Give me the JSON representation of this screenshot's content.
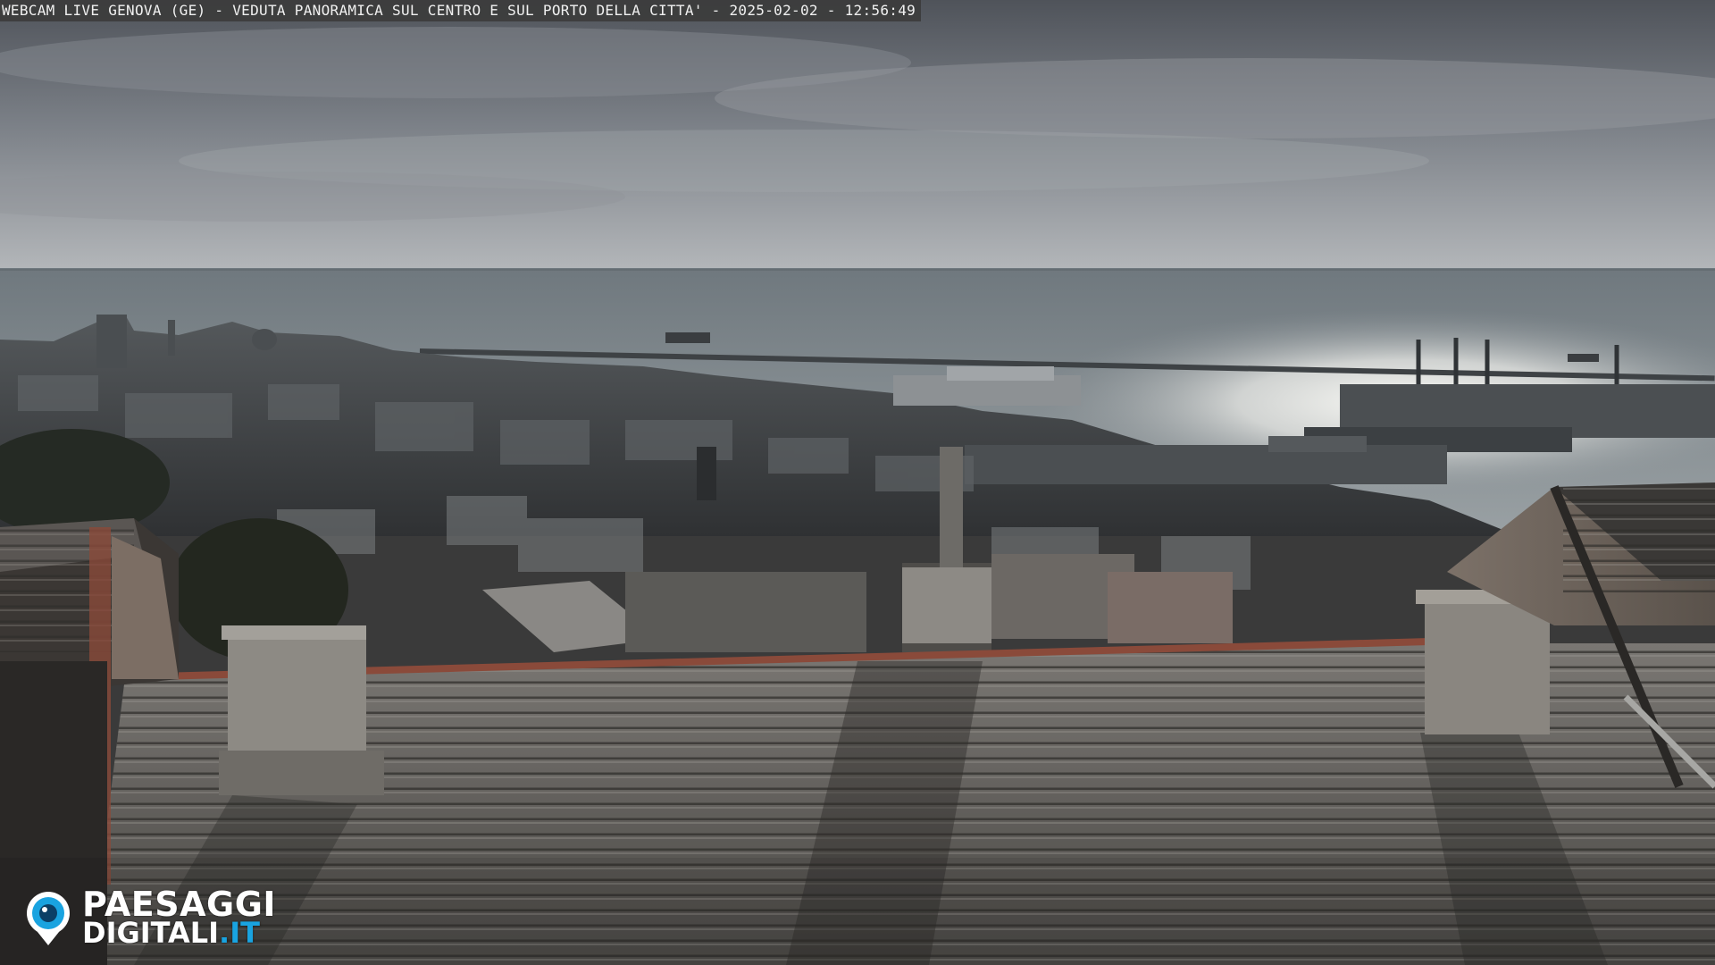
{
  "overlay": {
    "caption": "WEBCAM LIVE GENOVA (GE) - VEDUTA PANORAMICA SUL CENTRO E SUL PORTO DELLA CITTA' - 2025-02-02 - 12:56:49"
  },
  "brand": {
    "line1": "PAESAGGI",
    "line2_main": "DIGITALI",
    "line2_tld": ".IT",
    "accent_color": "#19a3e0",
    "icon": "eye-pin-icon"
  },
  "scene": {
    "subject": "panoramic-city-harbor-view",
    "palette": {
      "sky_top": "#5b5f66",
      "sky_bottom": "#a9adb2",
      "sea": "#8c9397",
      "sea_glare": "#f2f2ee",
      "city": "#3f4245",
      "roof": "#6c6a66",
      "roof_dark": "#2e2c2a",
      "terracotta": "#8a4a3a"
    }
  }
}
